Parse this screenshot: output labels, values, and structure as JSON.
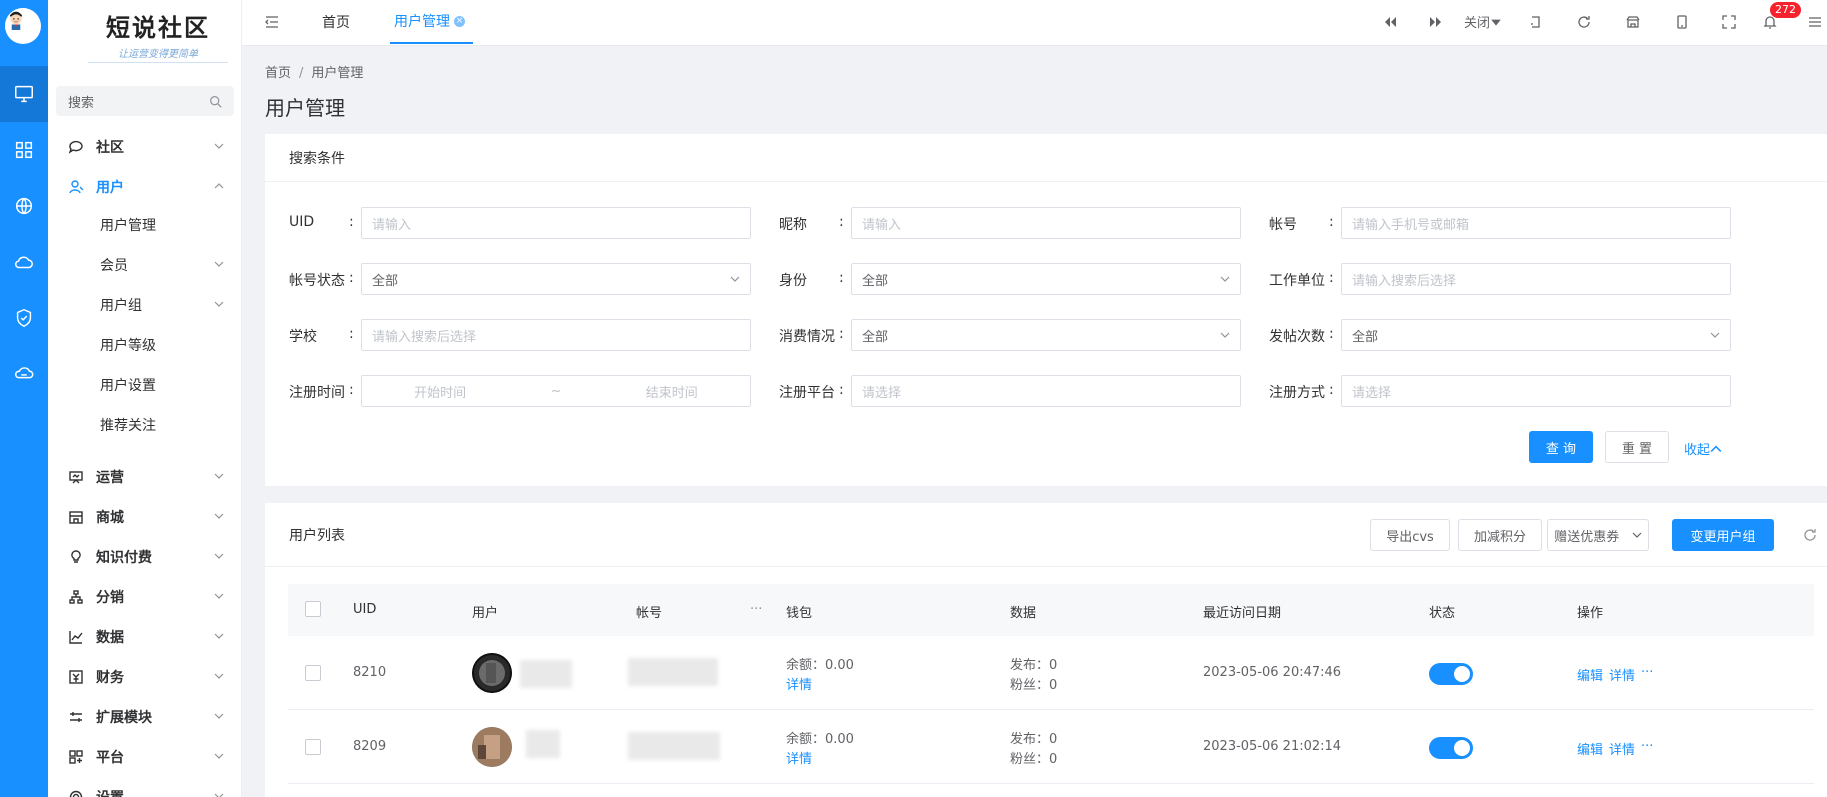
{
  "logo": {
    "title": "短说社区",
    "slogan": "让运营变得更简单"
  },
  "search": {
    "placeholder": "搜索"
  },
  "menu": {
    "community": "社区",
    "user": "用户",
    "user_sub": [
      "用户管理",
      "会员",
      "用户组",
      "用户等级",
      "用户设置",
      "推荐关注"
    ],
    "operation": "运营",
    "mall": "商城",
    "knowledge": "知识付费",
    "distribution": "分销",
    "data": "数据",
    "finance": "财务",
    "extension": "扩展模块",
    "platform": "平台",
    "settings": "设置"
  },
  "tabs": {
    "home": "首页",
    "user_mgmt": "用户管理",
    "close_dd": "关闭"
  },
  "notifications": {
    "count": "272"
  },
  "breadcrumb": {
    "home": "首页",
    "current": "用户管理"
  },
  "page_title": "用户管理",
  "filter": {
    "title": "搜索条件",
    "uid_label": "UID",
    "uid_ph": "请输入",
    "nickname_label": "昵称",
    "nickname_ph": "请输入",
    "account_label": "帐号",
    "account_ph": "请输入手机号或邮箱",
    "status_label": "帐号状态",
    "status_val": "全部",
    "identity_label": "身份",
    "identity_val": "全部",
    "work_label": "工作单位",
    "work_ph": "请输入搜索后选择",
    "school_label": "学校",
    "school_ph": "请输入搜索后选择",
    "consume_label": "消费情况",
    "consume_val": "全部",
    "posts_label": "发帖次数",
    "posts_val": "全部",
    "regtime_label": "注册时间",
    "start_ph": "开始时间",
    "tilde": "~",
    "end_ph": "结束时间",
    "regplat_label": "注册平台",
    "regplat_ph": "请选择",
    "regway_label": "注册方式",
    "regway_ph": "请选择",
    "colon": ":",
    "query_btn": "查 询",
    "reset_btn": "重 置",
    "collapse": "收起"
  },
  "list": {
    "title": "用户列表",
    "export": "导出cvs",
    "points": "加减积分",
    "coupon": "赠送优惠券",
    "change_group": "变更用户组",
    "columns": {
      "uid": "UID",
      "user": "用户",
      "account": "帐号",
      "more": "···",
      "wallet": "钱包",
      "data": "数据",
      "last_visit": "最近访问日期",
      "status": "状态",
      "ops": "操作"
    },
    "rows": [
      {
        "uid": "8210",
        "balance": "余额：0.00",
        "detail": "详情",
        "post": "发布：0",
        "fans": "粉丝：0",
        "last": "2023-05-06 20:47:46",
        "edit": "编辑",
        "op_detail": "详情",
        "op_more": "···"
      },
      {
        "uid": "8209",
        "balance": "余额：0.00",
        "detail": "详情",
        "post": "发布：0",
        "fans": "粉丝：0",
        "last": "2023-05-06 21:02:14",
        "edit": "编辑",
        "op_detail": "详情",
        "op_more": "···"
      }
    ]
  },
  "colors": {
    "primary": "#1890ff",
    "badge": "#f5222d"
  }
}
